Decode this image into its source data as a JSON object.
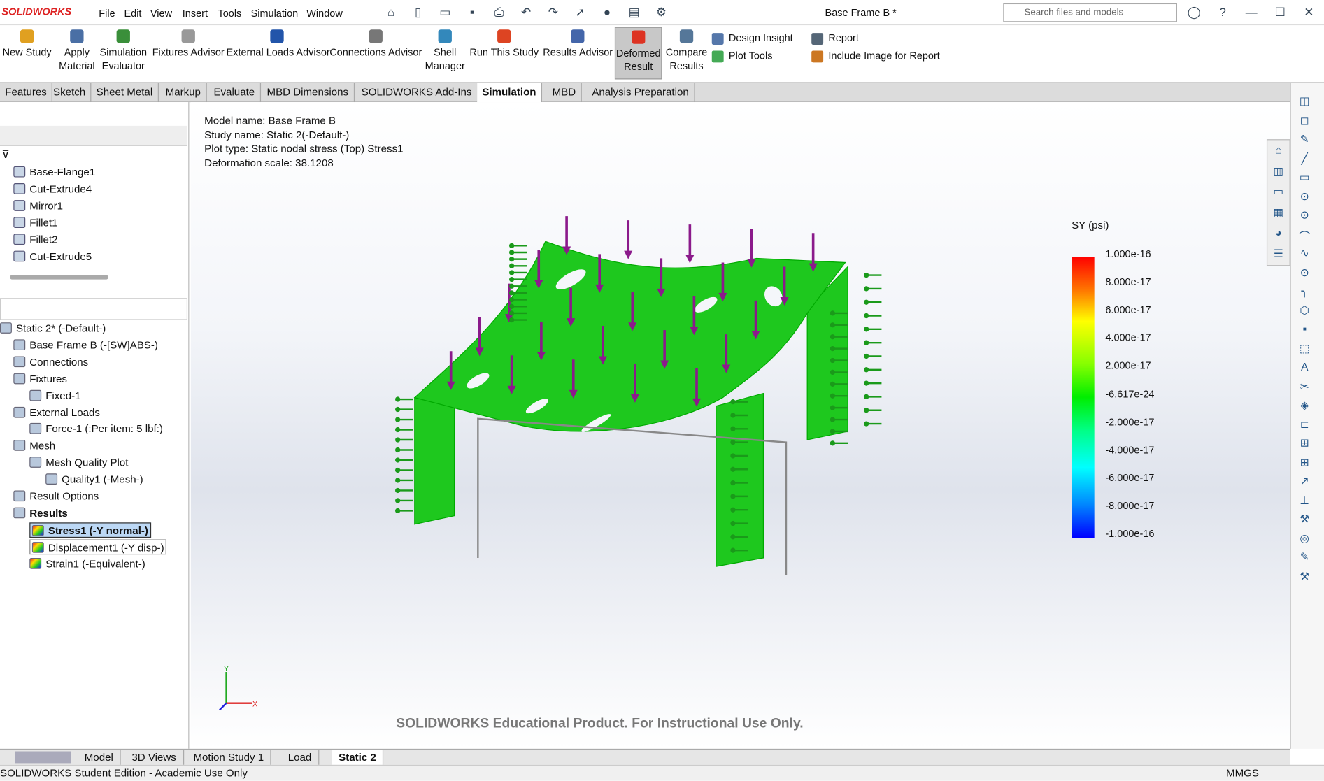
{
  "app": {
    "logo": "SOLIDWORKS",
    "title": "Base Frame B *",
    "search_placeholder": "Search files and models"
  },
  "menu": [
    "File",
    "Edit",
    "View",
    "Insert",
    "Tools",
    "Simulation",
    "Window"
  ],
  "ribbon": {
    "buttons": [
      {
        "label": "New Study",
        "color": "#e0a020"
      },
      {
        "label": "Apply\nMaterial",
        "color": "#4a6fa5"
      },
      {
        "label": "Simulation\nEvaluator",
        "color": "#3a8f3a"
      },
      {
        "label": "Fixtures Advisor",
        "color": "#999999"
      },
      {
        "label": "External Loads Advisor",
        "color": "#2255aa"
      },
      {
        "label": "Connections Advisor",
        "color": "#777777"
      },
      {
        "label": "Shell\nManager",
        "color": "#3388bb"
      },
      {
        "label": "Run This Study",
        "color": "#dd4422"
      },
      {
        "label": "Results Advisor",
        "color": "#4466aa"
      },
      {
        "label": "Deformed\nResult",
        "color": "#dd3322"
      },
      {
        "label": "Compare\nResults",
        "color": "#557799"
      }
    ],
    "small": [
      "Design Insight",
      "Plot Tools",
      "Report",
      "Include Image for Report"
    ]
  },
  "tabs": [
    "Features",
    "Sketch",
    "Sheet Metal",
    "Markup",
    "Evaluate",
    "MBD Dimensions",
    "SOLIDWORKS Add-Ins",
    "Simulation",
    "MBD",
    "Analysis Preparation"
  ],
  "selected_tab": "Simulation",
  "feature_tree": [
    "Base-Flange1",
    "Cut-Extrude4",
    "Mirror1",
    "Fillet1",
    "Fillet2",
    "Cut-Extrude5"
  ],
  "sim_tree": [
    {
      "label": "Static 2* (-Default-)",
      "level": 0
    },
    {
      "label": "Base Frame B (-[SW]ABS-)",
      "level": 1
    },
    {
      "label": "Connections",
      "level": 1
    },
    {
      "label": "Fixtures",
      "level": 1
    },
    {
      "label": "Fixed-1",
      "level": 2
    },
    {
      "label": "External Loads",
      "level": 1
    },
    {
      "label": "Force-1 (:Per item: 5 lbf:)",
      "level": 2
    },
    {
      "label": "Mesh",
      "level": 1
    },
    {
      "label": "Mesh Quality Plot",
      "level": 2
    },
    {
      "label": "Quality1 (-Mesh-)",
      "level": 3
    },
    {
      "label": "Result Options",
      "level": 1
    },
    {
      "label": "Results",
      "level": 1
    },
    {
      "label": "Stress1 (-Y normal-)",
      "level": 2
    },
    {
      "label": "Displacement1 (-Y disp-)",
      "level": 2
    },
    {
      "label": "Strain1 (-Equivalent-)",
      "level": 2
    }
  ],
  "info": [
    "Model name: Base Frame B",
    "Study name: Static 2(-Default-)",
    "Plot type: Static nodal stress (Top) Stress1",
    "Deformation scale: 38.1208"
  ],
  "legend": {
    "title": "SY (psi)",
    "labels": [
      "1.000e-16",
      "8.000e-17",
      "6.000e-17",
      "4.000e-17",
      "2.000e-17",
      "-6.617e-24",
      "-2.000e-17",
      "-4.000e-17",
      "-6.000e-17",
      "-8.000e-17",
      "-1.000e-16"
    ]
  },
  "watermark": "SOLIDWORKS Educational Product. For Instructional Use Only.",
  "triad": {
    "x": "X",
    "y": "Y"
  },
  "colors": {
    "model": "#1ec81e",
    "load_arrow": "#8b1a8b",
    "fixture": "#1a9a1a"
  },
  "bottom_tabs": [
    "Model",
    "3D Views",
    "Motion Study 1",
    "Load",
    "Static 2"
  ],
  "status": {
    "left": "SOLIDWORKS Student Edition - Academic Use Only",
    "units": "MMGS"
  }
}
